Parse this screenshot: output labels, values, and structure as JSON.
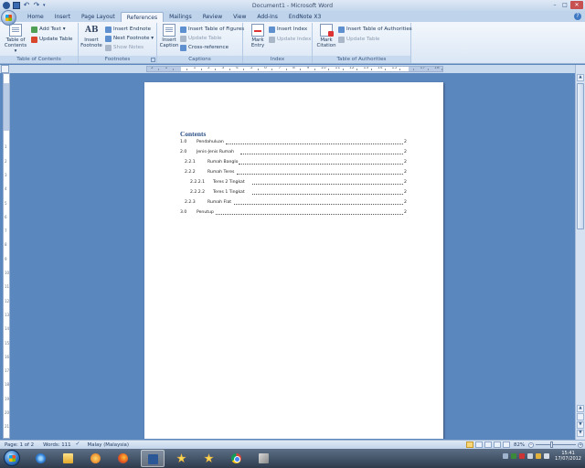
{
  "window": {
    "title": "Document1 - Microsoft Word",
    "minimize_glyph": "–",
    "maximize_glyph": "□",
    "close_glyph": "✕"
  },
  "quick_access": {
    "undo_glyph": "↶",
    "redo_glyph": "↷",
    "more_glyph": "▾"
  },
  "tabs": [
    {
      "label": "Home"
    },
    {
      "label": "Insert"
    },
    {
      "label": "Page Layout"
    },
    {
      "label": "References",
      "active": true
    },
    {
      "label": "Mailings"
    },
    {
      "label": "Review"
    },
    {
      "label": "View"
    },
    {
      "label": "Add-Ins"
    },
    {
      "label": "EndNote X3"
    }
  ],
  "help_glyph": "?",
  "ribbon": {
    "toc": {
      "toc_line1": "Table of",
      "toc_line2": "Contents ▾",
      "add_text": "Add Text ▾",
      "update_table": "Update Table",
      "group_label": "Table of Contents"
    },
    "footnotes": {
      "insert_footnote_line1": "Insert",
      "insert_footnote_line2": "Footnote",
      "insert_footnote_icon": "AB",
      "insert_endnote": "Insert Endnote",
      "next_footnote": "Next Footnote ▾",
      "show_notes": "Show Notes",
      "group_label": "Footnotes"
    },
    "captions": {
      "insert_caption_line1": "Insert",
      "insert_caption_line2": "Caption",
      "insert_table_of_figures": "Insert Table of Figures",
      "update_table": "Update Table",
      "cross_reference": "Cross-reference",
      "group_label": "Captions"
    },
    "index": {
      "mark_entry_line1": "Mark",
      "mark_entry_line2": "Entry",
      "insert_index": "Insert Index",
      "update_index": "Update Index",
      "group_label": "Index"
    },
    "authorities": {
      "mark_citation_line1": "Mark",
      "mark_citation_line2": "Citation",
      "insert_table_of_authorities": "Insert Table of Authorities",
      "update_table": "Update Table",
      "group_label": "Table of Authorities"
    }
  },
  "document": {
    "toc_heading": "Contents",
    "entries": [
      {
        "num": "1.0",
        "text": "Pendahuluan",
        "page": "2",
        "level": 1
      },
      {
        "num": "2.0",
        "text": "Jenis-Jenis Rumah",
        "page": "2",
        "level": 1
      },
      {
        "num": "2.2.1",
        "text": "Rumah Banglo",
        "page": "2",
        "level": 3
      },
      {
        "num": "2.2.2",
        "text": "Rumah Teres",
        "page": "2",
        "level": 3
      },
      {
        "num": "2.2.2.1",
        "text": "Teres 2 Tingkat",
        "page": "2",
        "level": 4
      },
      {
        "num": "2.2.2.2",
        "text": "Teres 1 Tingkat",
        "page": "2",
        "level": 4
      },
      {
        "num": "2.2.3",
        "text": "Rumah Flat",
        "page": "2",
        "level": 3
      },
      {
        "num": "3.0",
        "text": "Penutup",
        "page": "2",
        "level": 1
      }
    ]
  },
  "scrollbar": {
    "up_glyph": "▲",
    "down_glyph": "▼"
  },
  "statusbar": {
    "page": "Page: 1 of 2",
    "words": "Words: 111",
    "language": "Malay (Malaysia)",
    "zoom": "82%",
    "zoom_minus": "–",
    "zoom_plus": "+",
    "zoom_fraction": 0.41
  },
  "taskbar": {
    "apps": [
      "internet-explorer",
      "windows-explorer",
      "media-player",
      "firefox",
      "word",
      "app-star",
      "app-star-2",
      "chrome",
      "tool"
    ],
    "time": "15:41",
    "date": "17/07/2012"
  }
}
